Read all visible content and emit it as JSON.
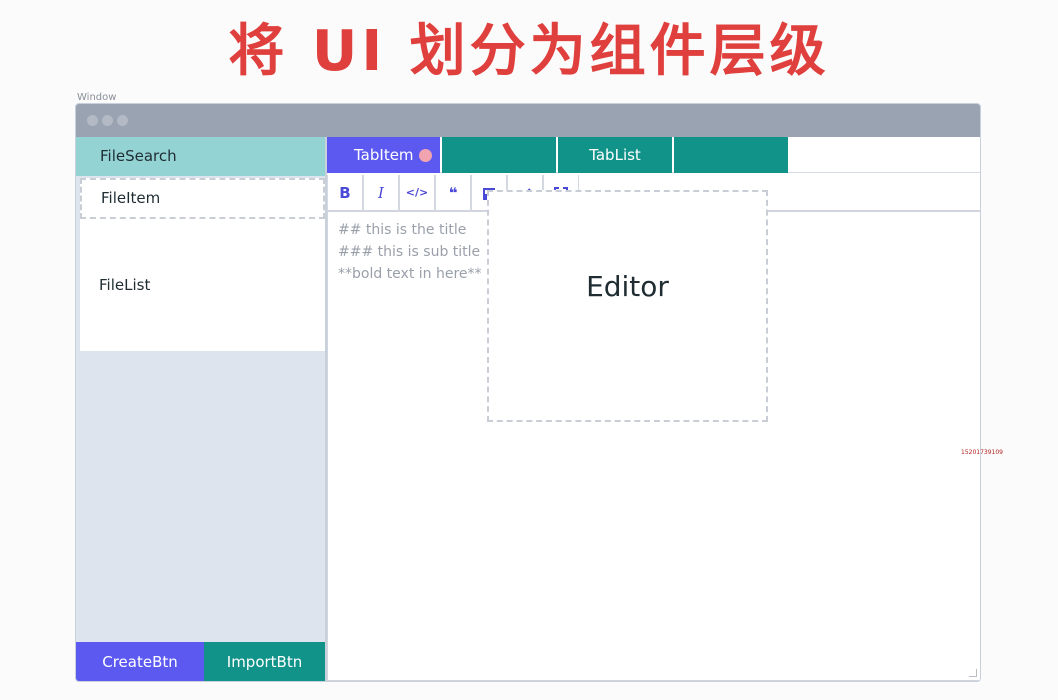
{
  "headline": "将 UI 划分为组件层级",
  "window_label": "Window",
  "sidebar": {
    "file_search": "FileSearch",
    "file_item": "FileItem",
    "file_list": "FileList",
    "create_btn": "CreateBtn",
    "import_btn": "ImportBtn"
  },
  "tabs": {
    "tab_item": "TabItem",
    "tab_list": "TabList"
  },
  "toolbar": {
    "icons": [
      "bold-icon",
      "italic-icon",
      "code-icon",
      "quote-icon",
      "image-icon",
      "link-icon",
      "fullscreen-icon"
    ],
    "bold": "B",
    "italic": "I",
    "code": "</>",
    "quote": "❝"
  },
  "editor": {
    "lines": [
      "## this is the title",
      "### this is sub title",
      "**bold text in here**"
    ],
    "label": "Editor"
  },
  "watermark": "15201739109",
  "colors": {
    "headline": "#e0403d",
    "primary": "#5b59f0",
    "teal": "#11938a",
    "search_bg": "#93d3d3",
    "unsaved_dot": "#f2a3b0"
  }
}
